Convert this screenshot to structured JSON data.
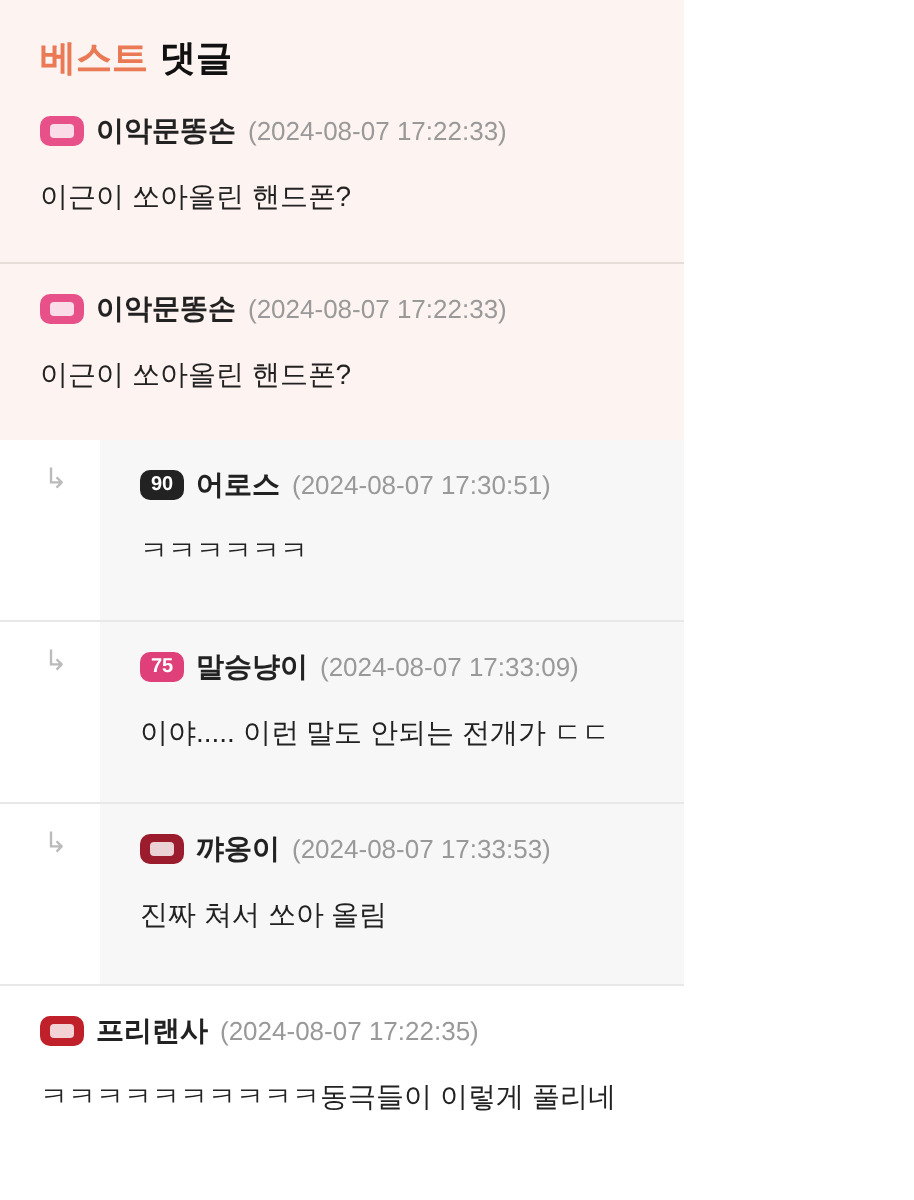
{
  "best_title": {
    "accent": "베스트",
    "rest": "댓글"
  },
  "best_comments": [
    {
      "author": "이악문똥손",
      "time": "(2024-08-07 17:22:33)",
      "text": "이근이 쏘아올린 핸드폰?",
      "badge": {
        "color": "#e8508a"
      }
    },
    {
      "author": "이악문똥손",
      "time": "(2024-08-07 17:22:33)",
      "text": "이근이 쏘아올린 핸드폰?",
      "badge": {
        "color": "#e8508a"
      }
    }
  ],
  "replies": [
    {
      "marker": "↳",
      "author": "어로스",
      "time": "(2024-08-07 17:30:51)",
      "text": "ㅋㅋㅋㅋㅋㅋ",
      "badge": {
        "color": "#222222",
        "level": "90"
      }
    },
    {
      "marker": "↳",
      "author": "말승냥이",
      "time": "(2024-08-07 17:33:09)",
      "text": "이야..... 이런 말도 안되는 전개가 ㄷㄷ",
      "badge": {
        "color": "#e0407a",
        "level": "75"
      }
    },
    {
      "marker": "↳",
      "author": "꺄옹이",
      "time": "(2024-08-07 17:33:53)",
      "text": "진짜 쳐서 쏘아 올림",
      "badge": {
        "color": "#9b1c2c"
      }
    }
  ],
  "comments": [
    {
      "author": "프리랜사",
      "time": "(2024-08-07 17:22:35)",
      "text": "ㅋㅋㅋㅋㅋㅋㅋㅋㅋㅋ동극들이 이렇게 풀리네",
      "badge": {
        "color": "#c0202a"
      }
    }
  ]
}
